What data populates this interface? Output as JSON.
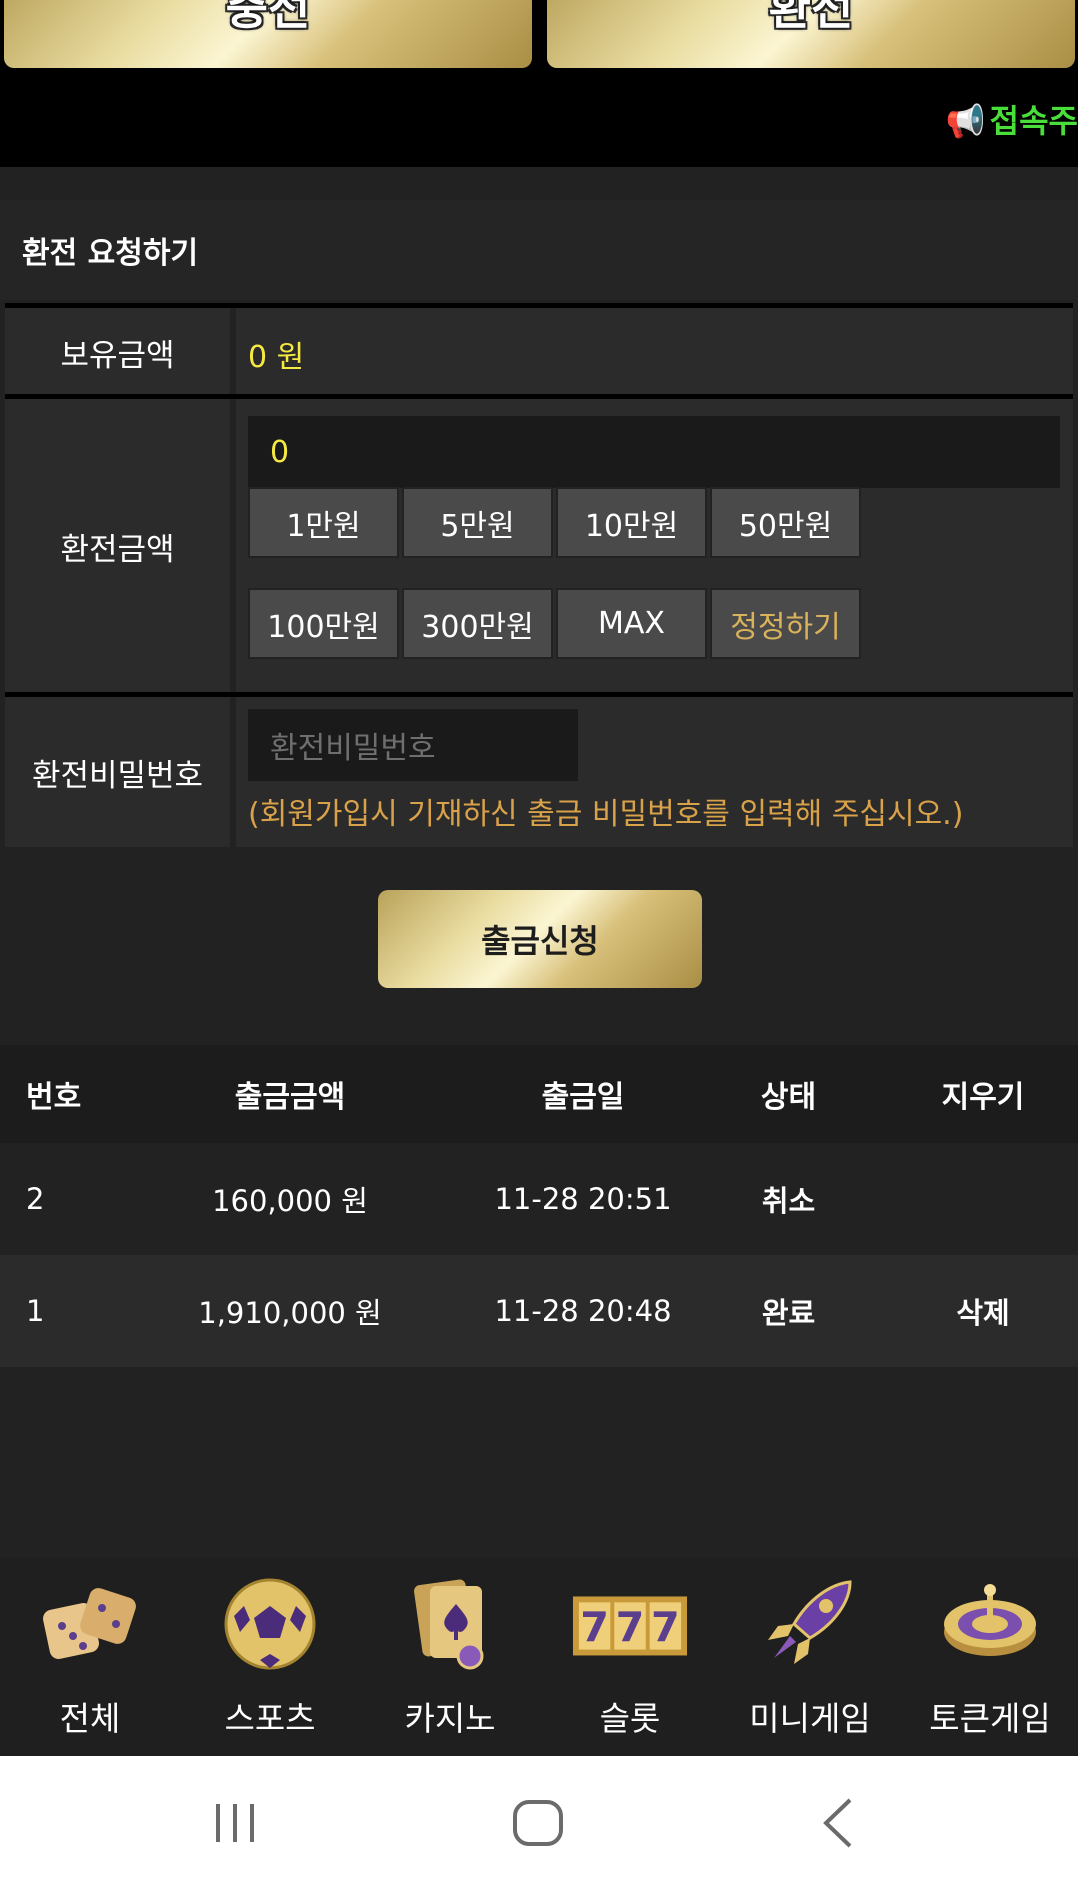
{
  "tabs": {
    "charge": "충전",
    "exchange": "환전"
  },
  "notice": {
    "icon": "megaphone-icon",
    "text": "접속주"
  },
  "section_title": "환전 요청하기",
  "form": {
    "balance_label": "보유금액",
    "balance_value": "0 원",
    "amount_label": "환전금액",
    "amount_value": "0",
    "quick_buttons": [
      "1만원",
      "5만원",
      "10만원",
      "50만원",
      "100만원",
      "300만원",
      "MAX",
      "정정하기"
    ],
    "password_label": "환전비밀번호",
    "password_placeholder": "환전비밀번호",
    "password_hint": "(회원가입시 기재하신 출금 비밀번호를 입력해 주십시오.)",
    "submit_label": "출금신청"
  },
  "history": {
    "headers": [
      "번호",
      "출금금액",
      "출금일",
      "상태",
      "지우기"
    ],
    "rows": [
      {
        "no": "2",
        "amount": "160,000 원",
        "date": "11-28 20:51",
        "status": "취소",
        "delete": ""
      },
      {
        "no": "1",
        "amount": "1,910,000 원",
        "date": "11-28 20:48",
        "status": "완료",
        "delete": "삭제"
      }
    ]
  },
  "nav": [
    {
      "label": "전체",
      "icon": "dice-icon"
    },
    {
      "label": "스포츠",
      "icon": "soccer-ball-icon"
    },
    {
      "label": "카지노",
      "icon": "playing-cards-icon"
    },
    {
      "label": "슬롯",
      "icon": "slot-777-icon"
    },
    {
      "label": "미니게임",
      "icon": "rocket-icon"
    },
    {
      "label": "토큰게임",
      "icon": "roulette-icon"
    }
  ],
  "colors": {
    "accent_gold": "#e9dca0",
    "highlight_yellow": "#f5e942",
    "hint_orange": "#d9a24a",
    "notice_green": "#4ade3a"
  }
}
